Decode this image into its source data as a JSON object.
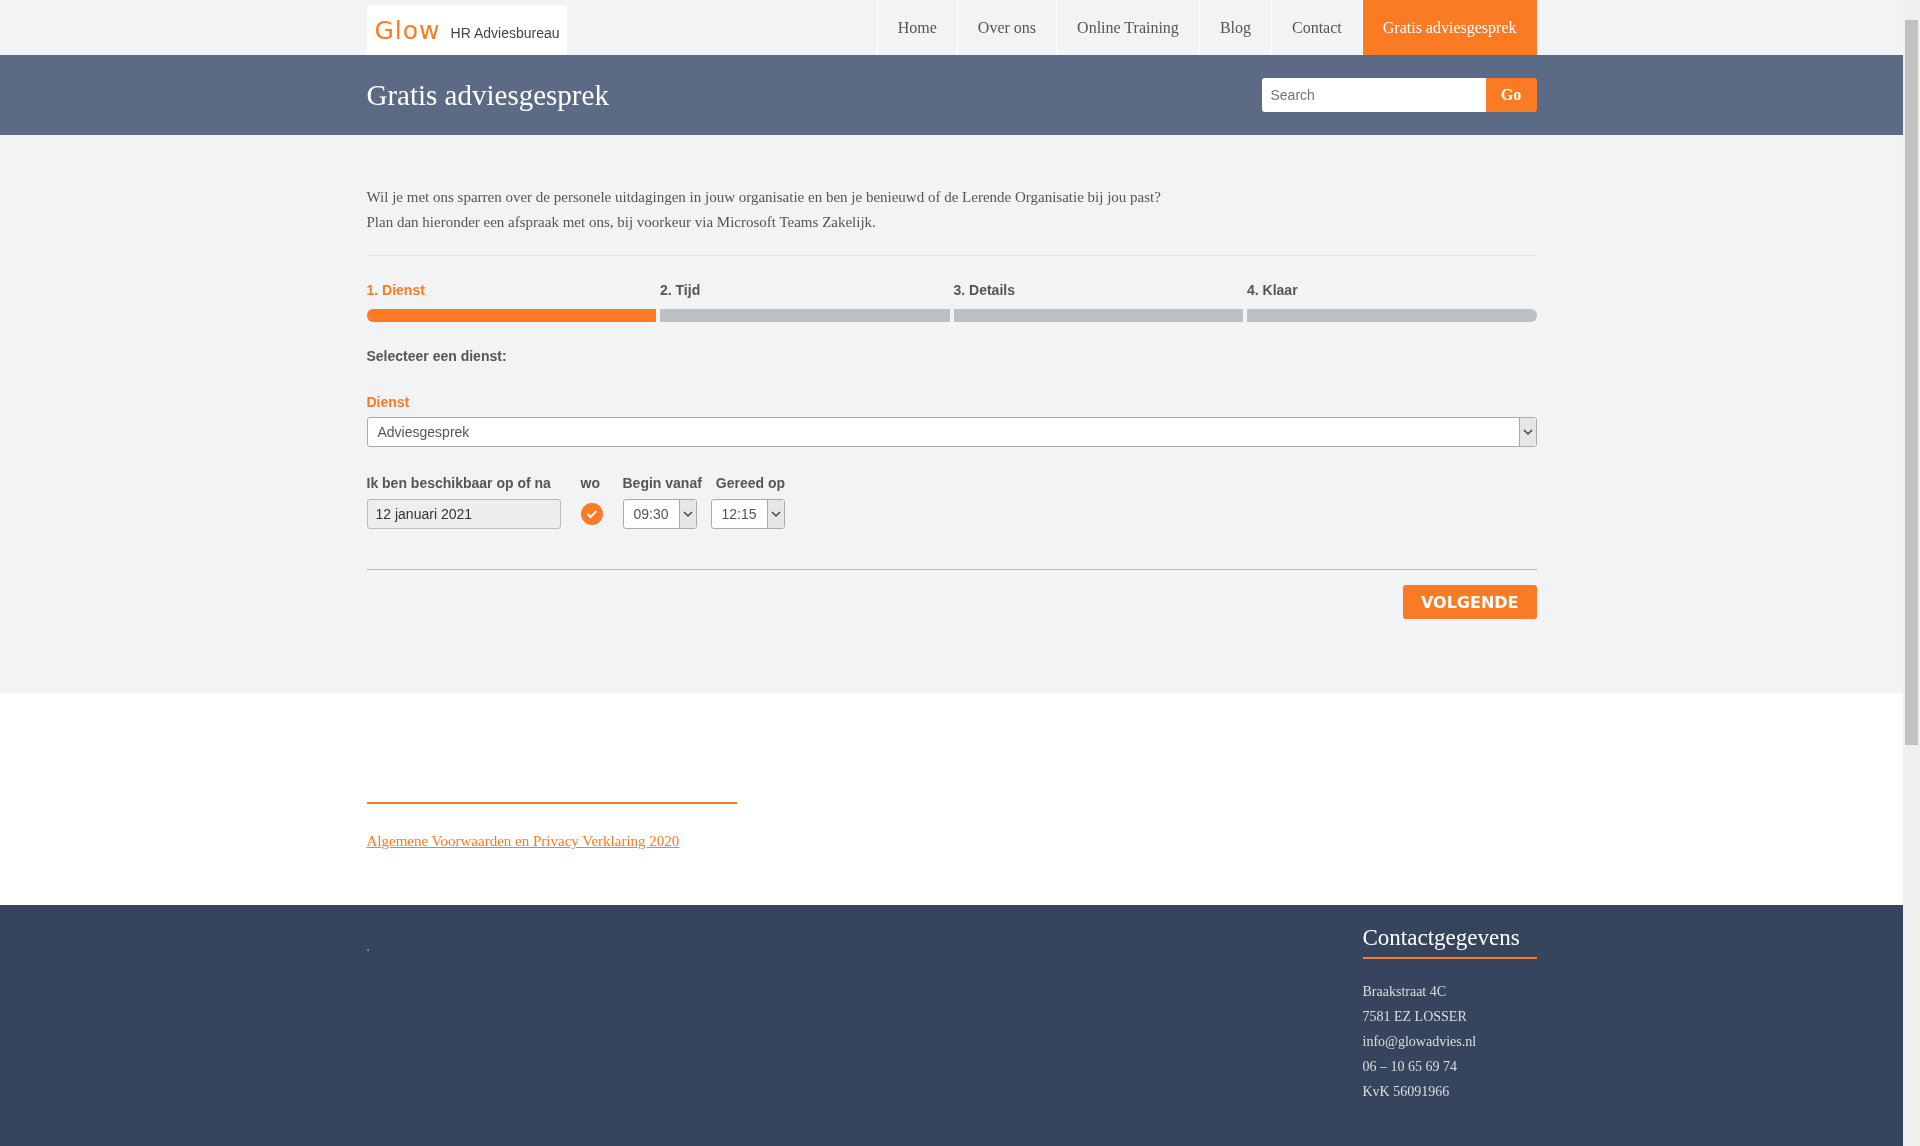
{
  "header": {
    "logo": {
      "brand": "Glow",
      "tagline": "HR Adviesbureau"
    },
    "nav": [
      {
        "label": "Home",
        "selected": false
      },
      {
        "label": "Over ons",
        "selected": false
      },
      {
        "label": "Online Training",
        "selected": false
      },
      {
        "label": "Blog",
        "selected": false
      },
      {
        "label": "Contact",
        "selected": false
      },
      {
        "label": "Gratis adviesgesprek",
        "selected": true
      }
    ]
  },
  "banner": {
    "title": "Gratis adviesgesprek",
    "search": {
      "placeholder": "Search",
      "button": "Go"
    }
  },
  "intro": [
    "Wil je met ons sparren over de personele uitdagingen in jouw organisatie en ben je benieuwd of de Lerende Organisatie bij jou past?",
    "Plan dan hieronder een afspraak met ons, bij voorkeur via Microsoft Teams Zakelijk."
  ],
  "steps": [
    {
      "label": "1. Dienst",
      "selected": true
    },
    {
      "label": "2. Tijd",
      "selected": false
    },
    {
      "label": "3. Details",
      "selected": false
    },
    {
      "label": "4. Klaar",
      "selected": false
    }
  ],
  "form": {
    "heading": "Selecteer een dienst:",
    "service_label": "Dienst",
    "service_value": "Adviesgesprek",
    "date_label": "Ik ben beschikbaar op of na",
    "date_value": "12 januari 2021",
    "weekday_label": "wo",
    "weekday_checked": true,
    "start_label": "Begin vanaf",
    "start_value": "09:30",
    "end_label": "Gereed op",
    "end_value": "12:15",
    "next_button": "VOLGENDE"
  },
  "terms_link": "Algemene Voorwaarden en Privacy Verklaring 2020",
  "footer": {
    "note": ".",
    "contact_title": "Contactgegevens",
    "contact_lines": [
      "Braakstraat 4C",
      "7581 EZ LOSSER",
      "info@glowadvies.nl",
      "06 – 10 65 69 74",
      "KvK 56091966"
    ]
  }
}
